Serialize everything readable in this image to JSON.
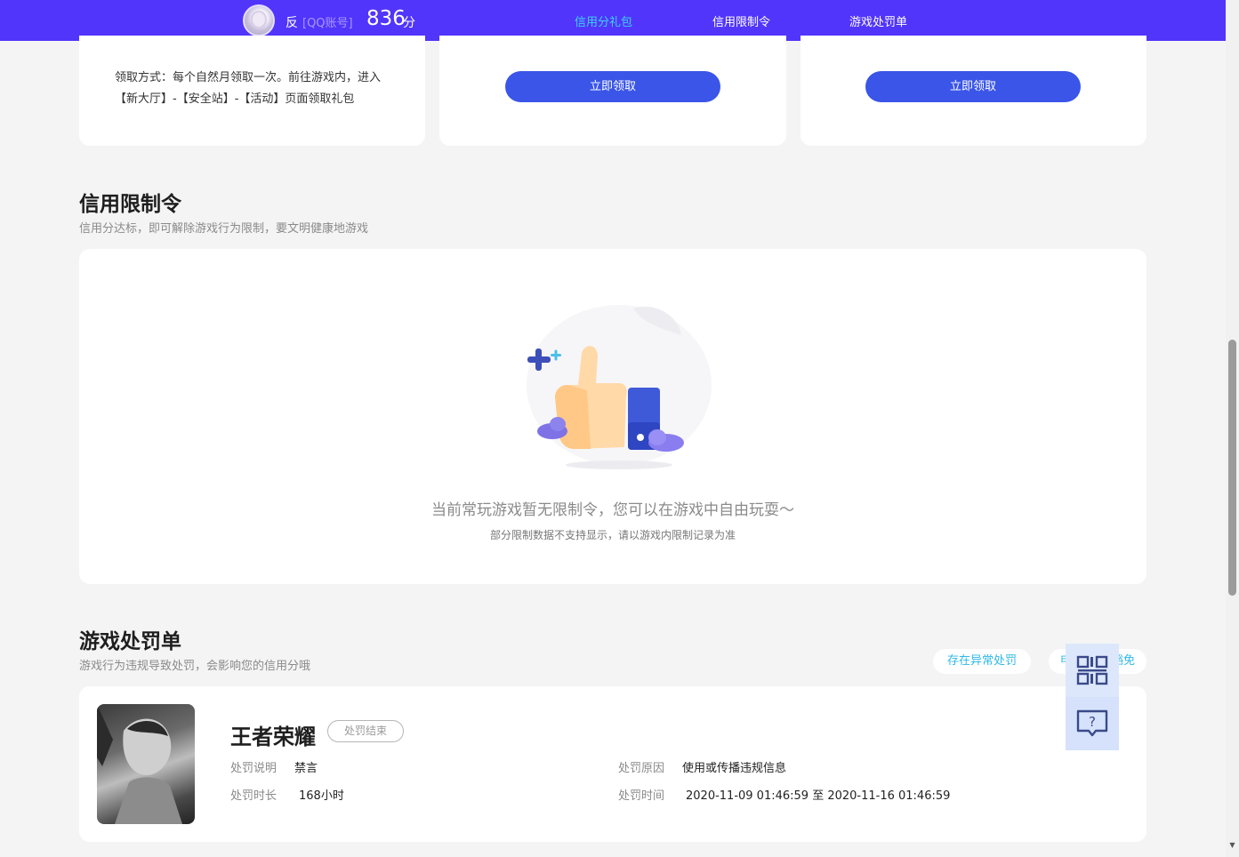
{
  "header": {
    "user_name": "反",
    "account_type": "[QQ账号]",
    "score": "836",
    "score_unit": "分",
    "tabs": [
      {
        "label": "信用分礼包",
        "active": true
      },
      {
        "label": "信用限制令",
        "active": false
      },
      {
        "label": "游戏处罚单",
        "active": false
      }
    ]
  },
  "gift_cards": {
    "claim_method": "领取方式：每个自然月领取一次。前往游戏内，进入【新大厅】-【安全站】-【活动】页面领取礼包",
    "claim_button": "立即领取"
  },
  "restriction": {
    "title": "信用限制令",
    "subtitle": "信用分达标，即可解除游戏行为限制，要文明健康地游戏",
    "empty_main": "当前常玩游戏暂无限制令，您可以在游戏中自由玩耍～",
    "empty_sub": "部分限制数据不支持显示，请以游戏内限制记录为准"
  },
  "penalty": {
    "title": "游戏处罚单",
    "subtitle": "游戏行为违规导致处罚，会影响您的信用分哦",
    "abnormal_button": "存在异常处罚",
    "exemption_button_visible": "申",
    "exemption_button_tail": "豁免",
    "records": [
      {
        "game": "王者荣耀",
        "status": "处罚结束",
        "desc_label": "处罚说明",
        "desc": "禁言",
        "duration_label": "处罚时长",
        "duration": "168小时",
        "reason_label": "处罚原因",
        "reason": "使用或传播违规信息",
        "time_label": "处罚时间",
        "time": "2020-11-09 01:46:59 至 2020-11-16 01:46:59"
      }
    ]
  },
  "floating": {
    "qr_icon": "qrcode-icon",
    "help_icon": "help-chat-icon",
    "help_glyph": "?"
  },
  "colors": {
    "topbar": "#5135fb",
    "active_tab": "#3fd2ff",
    "button": "#3a55e8",
    "pill_text": "#2fb8e6",
    "float_bg": "#d6e2fb"
  }
}
